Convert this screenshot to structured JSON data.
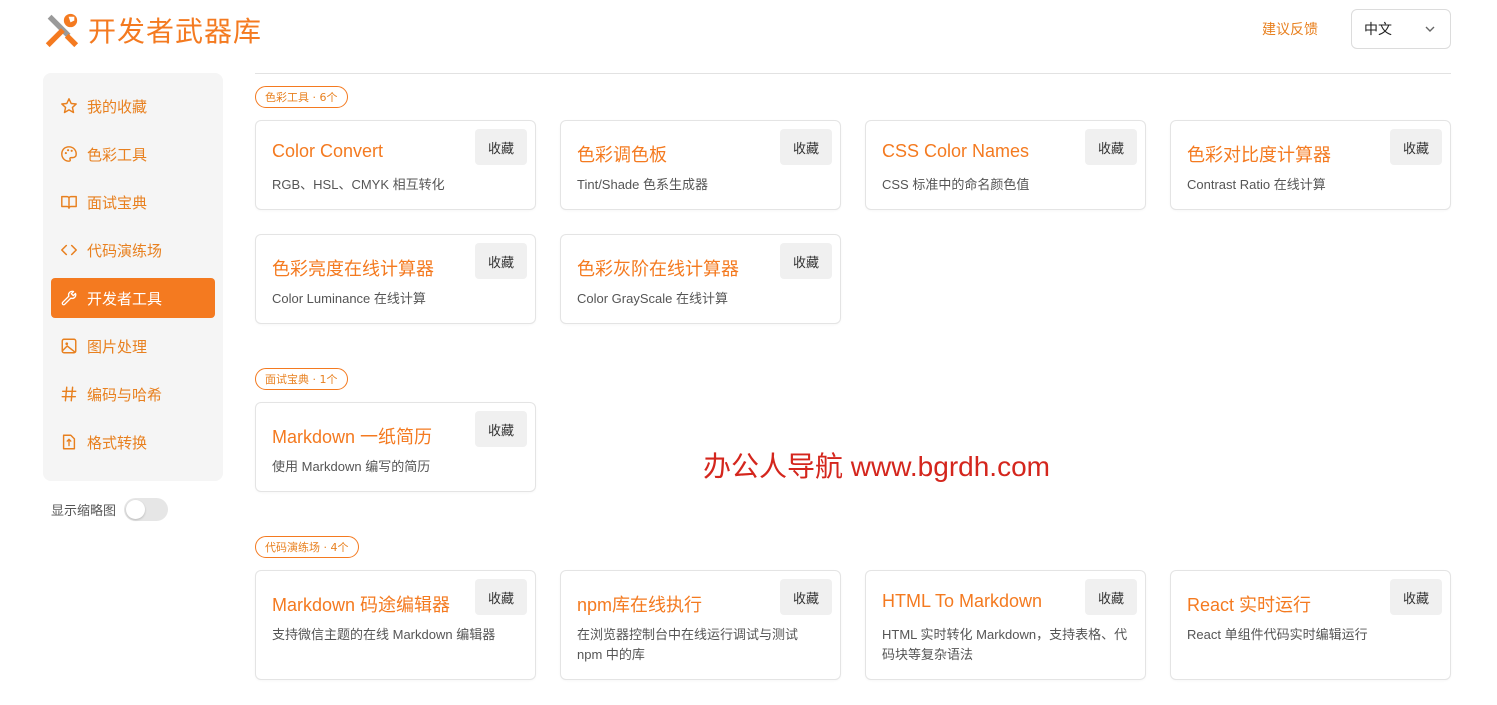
{
  "header": {
    "app_title": "开发者武器库",
    "feedback_label": "建议反馈",
    "language_selected": "中文"
  },
  "sidebar": {
    "items": [
      {
        "label": "我的收藏",
        "icon": "star-icon"
      },
      {
        "label": "色彩工具",
        "icon": "palette-icon"
      },
      {
        "label": "面试宝典",
        "icon": "book-icon"
      },
      {
        "label": "代码演练场",
        "icon": "code-icon"
      },
      {
        "label": "开发者工具",
        "icon": "wrench-icon",
        "active": true
      },
      {
        "label": "图片处理",
        "icon": "image-icon"
      },
      {
        "label": "编码与哈希",
        "icon": "hash-icon"
      },
      {
        "label": "格式转换",
        "icon": "file-convert-icon"
      }
    ],
    "thumbnail_toggle_label": "显示缩略图",
    "thumbnail_toggle_on": false
  },
  "sections": [
    {
      "badge": "色彩工具 · 6个",
      "cards": [
        {
          "title": "Color Convert",
          "desc": "RGB、HSL、CMYK 相互转化",
          "fav": "收藏"
        },
        {
          "title": "色彩调色板",
          "desc": "Tint/Shade 色系生成器",
          "fav": "收藏"
        },
        {
          "title": "CSS Color Names",
          "desc": "CSS 标准中的命名颜色值",
          "fav": "收藏"
        },
        {
          "title": "色彩对比度计算器",
          "desc": "Contrast Ratio 在线计算",
          "fav": "收藏"
        },
        {
          "title": "色彩亮度在线计算器",
          "desc": "Color Luminance 在线计算",
          "fav": "收藏"
        },
        {
          "title": "色彩灰阶在线计算器",
          "desc": "Color GrayScale 在线计算",
          "fav": "收藏"
        }
      ]
    },
    {
      "badge": "面试宝典 · 1个",
      "cards": [
        {
          "title": "Markdown 一纸简历",
          "desc": "使用 Markdown 编写的简历",
          "fav": "收藏"
        }
      ]
    },
    {
      "badge": "代码演练场 · 4个",
      "cards": [
        {
          "title": "Markdown 码途编辑器",
          "desc": "支持微信主题的在线 Markdown 编辑器",
          "fav": "收藏"
        },
        {
          "title": "npm库在线执行",
          "desc": "在浏览器控制台中在线运行调试与测试 npm 中的库",
          "fav": "收藏"
        },
        {
          "title": "HTML To Markdown",
          "desc": "HTML 实时转化 Markdown，支持表格、代码块等复杂语法",
          "fav": "收藏"
        },
        {
          "title": "React 实时运行",
          "desc": "React 单组件代码实时编辑运行",
          "fav": "收藏"
        }
      ]
    }
  ],
  "watermark": "办公人导航 www.bgrdh.com",
  "colors": {
    "accent": "#f47a20",
    "sidebar_bg": "#f5f5f5",
    "watermark": "#d4261d"
  }
}
